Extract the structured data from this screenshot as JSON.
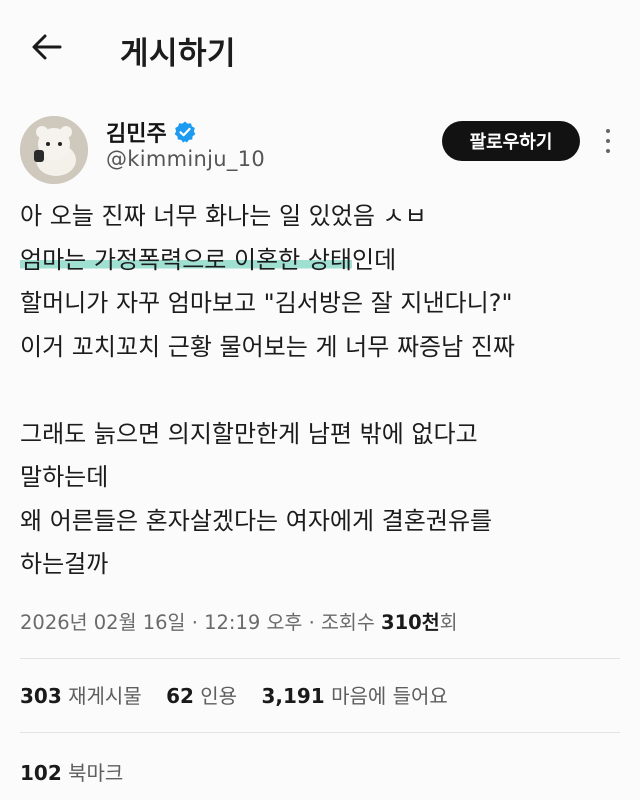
{
  "header": {
    "title": "게시하기"
  },
  "author": {
    "name": "김민주",
    "handle": "@kimminju_10",
    "follow_label": "팔로우하기"
  },
  "tweet": {
    "line1": "아 오늘 진짜 너무 화나는 일 있었음 ㅅㅂ",
    "line2_highlight": "엄마는 가정폭력으로 이혼한 상태",
    "line2_rest": "인데",
    "line3": "할머니가 자꾸 엄마보고 \"김서방은 잘 지낸다니?\"",
    "line4": "이거 꼬치꼬치 근황 물어보는 게 너무 짜증남 진짜",
    "line5": "그래도 늙으면 의지할만한게 남편 밖에 없다고",
    "line6": "말하는데",
    "line7": "왜 어른들은 혼자살겠다는 여자에게 결혼권유를",
    "line8": "하는걸까"
  },
  "meta": {
    "date": "2026년 02월 16일",
    "time": "12:19 오후",
    "views_label": "조회수",
    "views_count": "310천",
    "views_suffix": "회",
    "sep": "·"
  },
  "stats": {
    "reposts_count": "303",
    "reposts_label": "재게시물",
    "quotes_count": "62",
    "quotes_label": "인용",
    "likes_count": "3,191",
    "likes_label": "마음에 들어요",
    "bookmarks_count": "102",
    "bookmarks_label": "북마크"
  },
  "colors": {
    "highlight": "#9fe0d2",
    "verified": "#1d9bf0",
    "follow_bg": "#121212"
  }
}
